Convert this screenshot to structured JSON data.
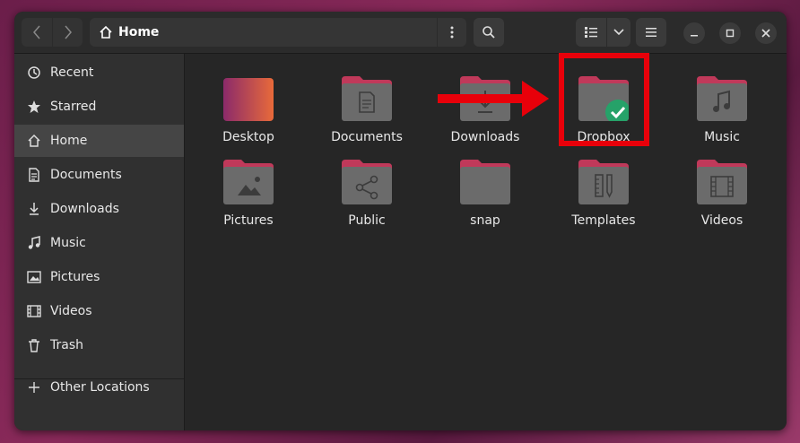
{
  "window": {
    "location_title": "Home"
  },
  "sidebar": {
    "items": [
      {
        "label": "Recent",
        "icon": "clock-icon"
      },
      {
        "label": "Starred",
        "icon": "star-icon"
      },
      {
        "label": "Home",
        "icon": "home-icon",
        "active": true
      },
      {
        "label": "Documents",
        "icon": "document-icon"
      },
      {
        "label": "Downloads",
        "icon": "download-icon"
      },
      {
        "label": "Music",
        "icon": "music-icon"
      },
      {
        "label": "Pictures",
        "icon": "picture-icon"
      },
      {
        "label": "Videos",
        "icon": "video-icon"
      },
      {
        "label": "Trash",
        "icon": "trash-icon"
      }
    ],
    "other_locations": "Other Locations"
  },
  "folders": [
    {
      "label": "Desktop",
      "icon": "desktop-folder-icon"
    },
    {
      "label": "Documents",
      "icon": "documents-folder-icon"
    },
    {
      "label": "Downloads",
      "icon": "downloads-folder-icon"
    },
    {
      "label": "Dropbox",
      "icon": "dropbox-folder-icon",
      "synced": true
    },
    {
      "label": "Music",
      "icon": "music-folder-icon"
    },
    {
      "label": "Pictures",
      "icon": "pictures-folder-icon"
    },
    {
      "label": "Public",
      "icon": "public-folder-icon"
    },
    {
      "label": "snap",
      "icon": "folder-icon"
    },
    {
      "label": "Templates",
      "icon": "templates-folder-icon"
    },
    {
      "label": "Videos",
      "icon": "videos-folder-icon"
    }
  ],
  "colors": {
    "folder_tab": "#c0395a",
    "folder_body": "#6b6b6b",
    "annotation": "#e8000a",
    "sync_badge": "#26a269"
  }
}
